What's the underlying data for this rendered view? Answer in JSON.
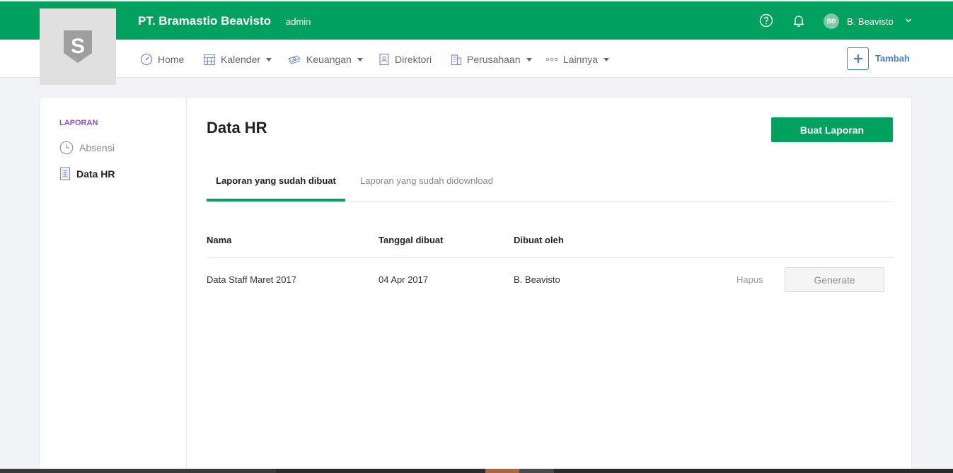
{
  "header": {
    "company_name": "PT. Bramastio Beavisto",
    "role": "admin",
    "user_initials": "BB",
    "user_name": "B. Beavisto",
    "logo_letter": "S"
  },
  "nav": {
    "items": [
      {
        "label": "Home",
        "icon": "gauge-icon"
      },
      {
        "label": "Kalender",
        "icon": "calendar-icon"
      },
      {
        "label": "Keuangan",
        "icon": "money-icon"
      },
      {
        "label": "Direktori",
        "icon": "directory-icon"
      },
      {
        "label": "Perusahaan",
        "icon": "building-icon"
      },
      {
        "label": "Lainnya",
        "icon": "dots-icon"
      }
    ],
    "add_label": "Tambah"
  },
  "sidebar": {
    "heading": "LAPORAN",
    "items": [
      {
        "label": "Absensi",
        "icon": "clock-icon"
      },
      {
        "label": "Data HR",
        "icon": "document-icon"
      }
    ]
  },
  "main": {
    "title": "Data HR",
    "create_button": "Buat Laporan",
    "tabs": [
      {
        "label": "Laporan yang sudah dibuat"
      },
      {
        "label": "Laporan yang sudah didownload"
      }
    ],
    "table": {
      "columns": [
        "Nama",
        "Tanggal dibuat",
        "Dibuat oleh"
      ],
      "rows": [
        {
          "name": "Data Staff Maret 2017",
          "date": "04 Apr 2017",
          "created_by": "B. Beavisto",
          "delete_label": "Hapus",
          "generate_label": "Generate"
        }
      ]
    }
  },
  "colors": {
    "brand_green": "#00a05e",
    "link_blue": "#4a7fd6",
    "sidebar_heading": "#8a4fd8"
  }
}
